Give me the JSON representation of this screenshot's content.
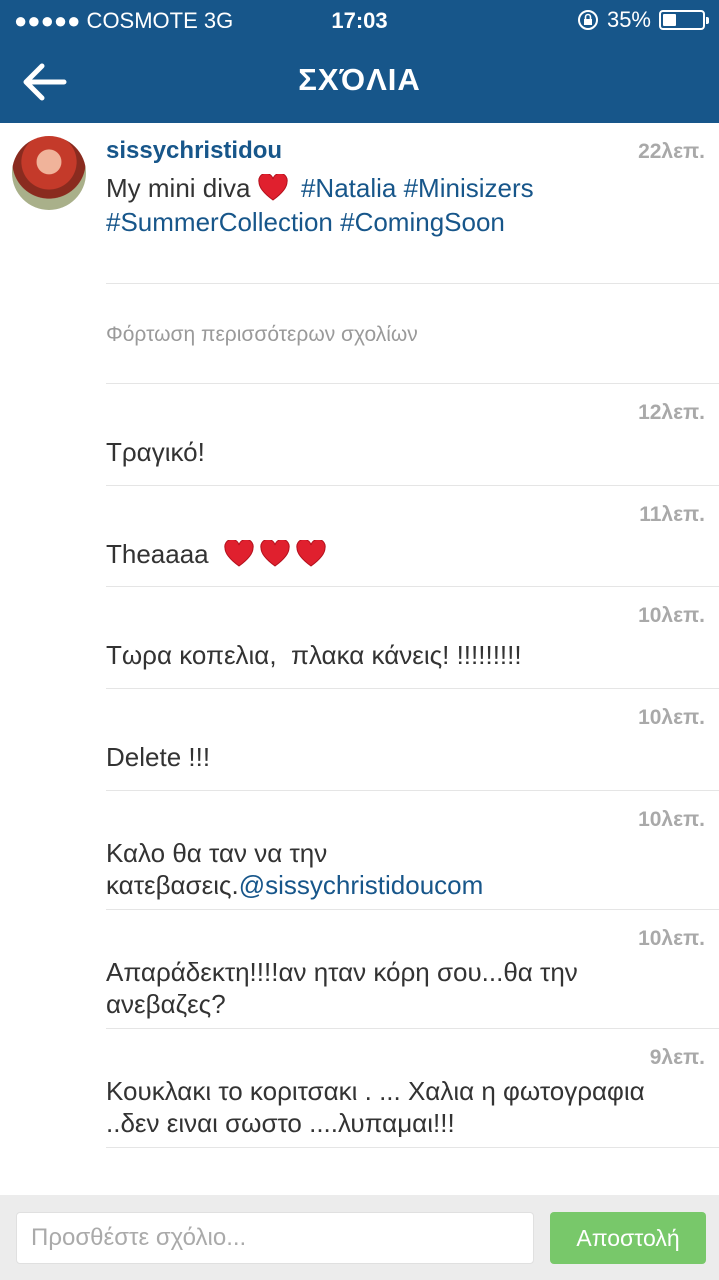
{
  "status_bar": {
    "carrier": "●●●●● COSMOTE   3G",
    "time": "17:03",
    "battery": "35%",
    "battery_level": 0.35
  },
  "header": {
    "title": "ΣΧΌΛΙΑ",
    "back_icon": "arrow-left-icon"
  },
  "caption": {
    "username": "sissychristidou",
    "time": "22λεπ.",
    "text_before": "My mini diva",
    "hashtags": [
      "#Natalia",
      "#Minisizers",
      "#SummerCollection",
      "#ComingSoon"
    ]
  },
  "load_more": "Φόρτωση περισσότερων σχολίων",
  "comments": [
    {
      "time": "12λεπ.",
      "text": "Τραγικό!"
    },
    {
      "time": "11λεπ.",
      "text": "Theaaaa"
    },
    {
      "time": "10λεπ.",
      "text": "Τωρα κοπελια,  πλακα κάνεις! !!!!!!!!!"
    },
    {
      "time": "10λεπ.",
      "text": "Delete !!!"
    },
    {
      "time": "10λεπ.",
      "text": "Καλο θα ταν να την κατεβασεις.",
      "mention": "@sissychristidoucom"
    },
    {
      "time": "10λεπ.",
      "text": "Απαράδεκτη!!!!αν ηταν κόρη σου...θα την ανεβαζες?"
    },
    {
      "time": "9λεπ.",
      "text": "Κουκλακι το κοριτσακι . ... Χαλια η φωτογραφια ..δεν ειναι σωστο ....λυπαμαι!!!"
    }
  ],
  "compose": {
    "placeholder": "Προσθέστε σχόλιο...",
    "send_label": "Αποστολή"
  },
  "colors": {
    "brand": "#17568a",
    "send": "#78c86a",
    "heart": "#e0202e"
  }
}
